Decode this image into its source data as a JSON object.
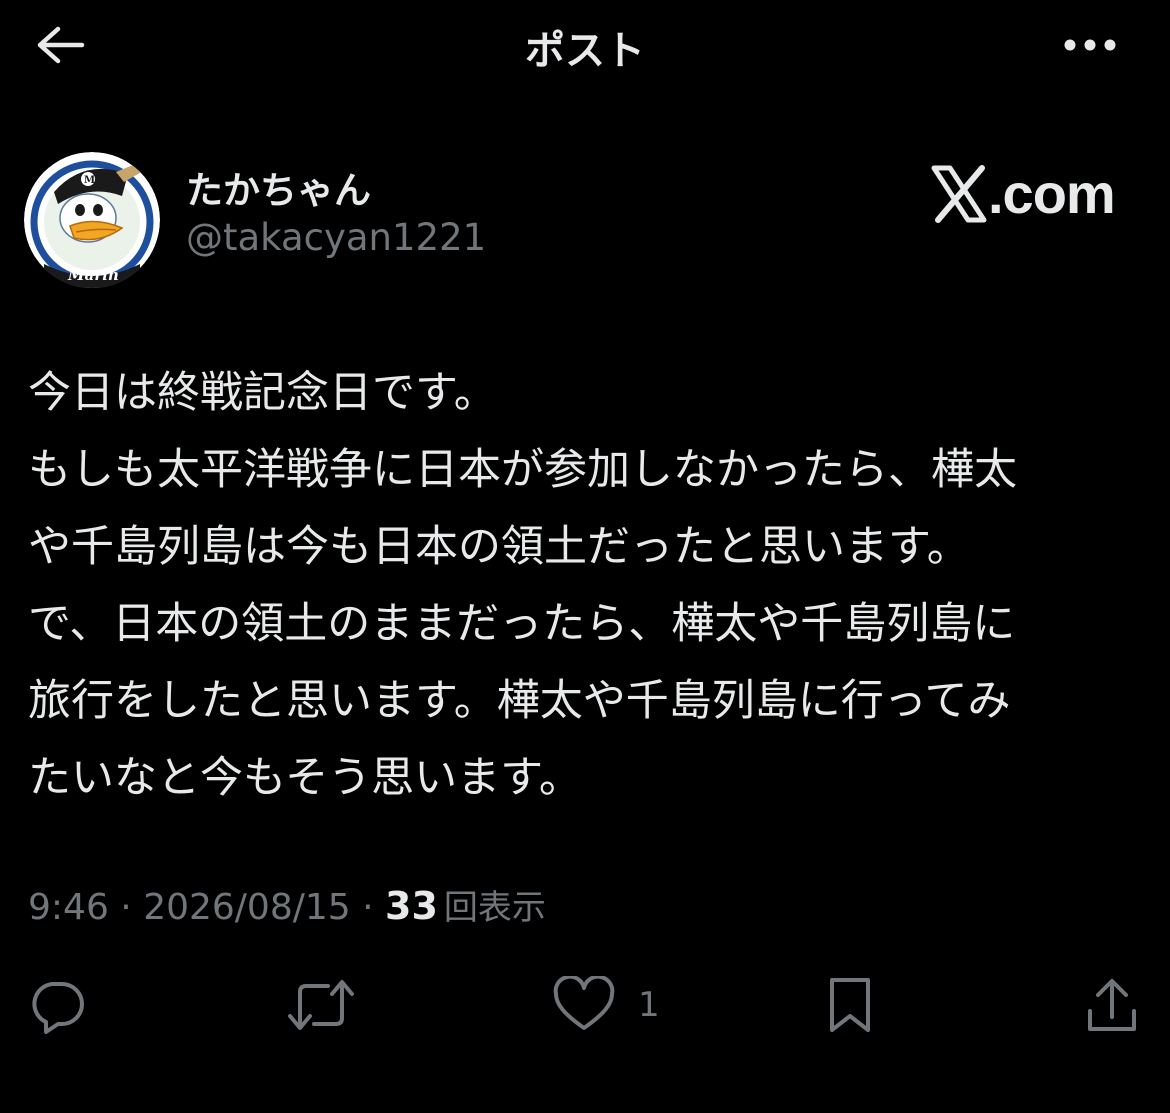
{
  "header": {
    "title": "ポスト",
    "back_icon": "arrow-left-icon",
    "more_icon": "more-horizontal-icon"
  },
  "author": {
    "display_name": "たかちゃん",
    "handle": "@takacyan1221",
    "avatar": "mascot-avatar"
  },
  "brand": {
    "text": ".com",
    "logo": "x-logo-icon"
  },
  "post": {
    "lines": [
      "今日は終戦記念日です。",
      "もしも太平洋戦争に日本が参加しなかったら、樺太",
      "や千島列島は今も日本の領土だったと思います。",
      "で、日本の領土のままだったら、樺太や千島列島に",
      "旅行をしたと思います。樺太や千島列島に行ってみ",
      "たいなと今もそう思います。"
    ]
  },
  "meta": {
    "time": "9:46",
    "separator": " · ",
    "date": "2026/08/15",
    "views_count": "33",
    "views_label": "回表示"
  },
  "actions": {
    "reply_icon": "reply-icon",
    "repost_icon": "repost-icon",
    "like_icon": "heart-icon",
    "like_count": "1",
    "bookmark_icon": "bookmark-icon",
    "share_icon": "share-icon"
  },
  "colors": {
    "background": "#000000",
    "primary_text": "#e7e9ea",
    "secondary_text": "#71767b"
  }
}
